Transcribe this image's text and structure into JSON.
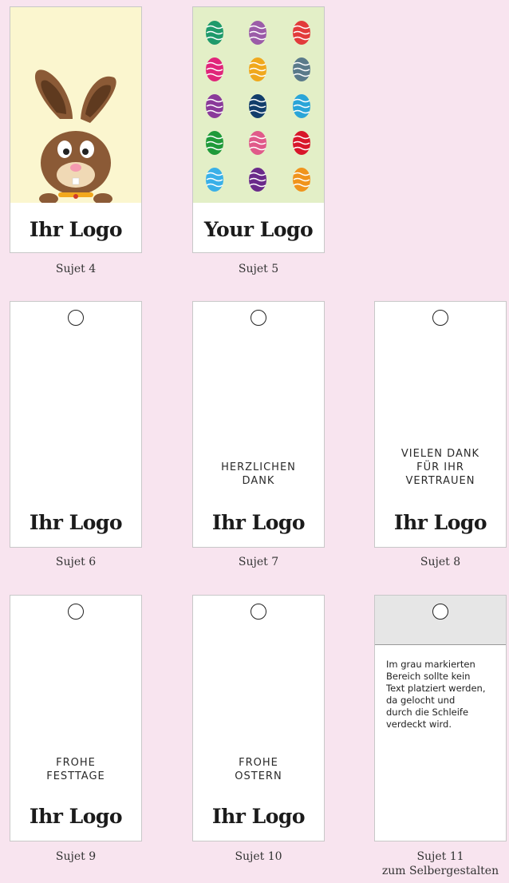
{
  "tags": [
    {
      "caption": "Sujet 4",
      "logo": "Ihr Logo",
      "bg": "#fbf6cf",
      "art": "bunny-illustration"
    },
    {
      "caption": "Sujet 5",
      "logo": "Your Logo",
      "bg": "#e3efc7",
      "art": "easter-eggs-pattern"
    },
    {
      "caption": "Sujet 6",
      "logo": "Ihr Logo"
    },
    {
      "caption": "Sujet 7",
      "logo": "Ihr Logo",
      "message": [
        "HERZLICHEN",
        "DANK"
      ]
    },
    {
      "caption": "Sujet 8",
      "logo": "Ihr Logo",
      "message": [
        "VIELEN DANK",
        "FÜR IHR",
        "VERTRAUEN"
      ]
    },
    {
      "caption": "Sujet 9",
      "logo": "Ihr Logo",
      "message": [
        "FROHE",
        "FESTTAGE"
      ]
    },
    {
      "caption": "Sujet 10",
      "logo": "Ihr Logo",
      "message": [
        "FROHE",
        "OSTERN"
      ]
    },
    {
      "caption": "Sujet 11",
      "caption_line2": "zum Selbergestalten",
      "info": [
        "Im grau markierten",
        "Bereich sollte kein",
        "Text platziert werden,",
        "da gelocht und",
        "durch die Schleife",
        "verdeckt wird."
      ]
    }
  ],
  "colors": {
    "page_bg": "#f8e4ef",
    "bunny": "#8b5a36",
    "grey_zone": "#e6e6e6"
  }
}
